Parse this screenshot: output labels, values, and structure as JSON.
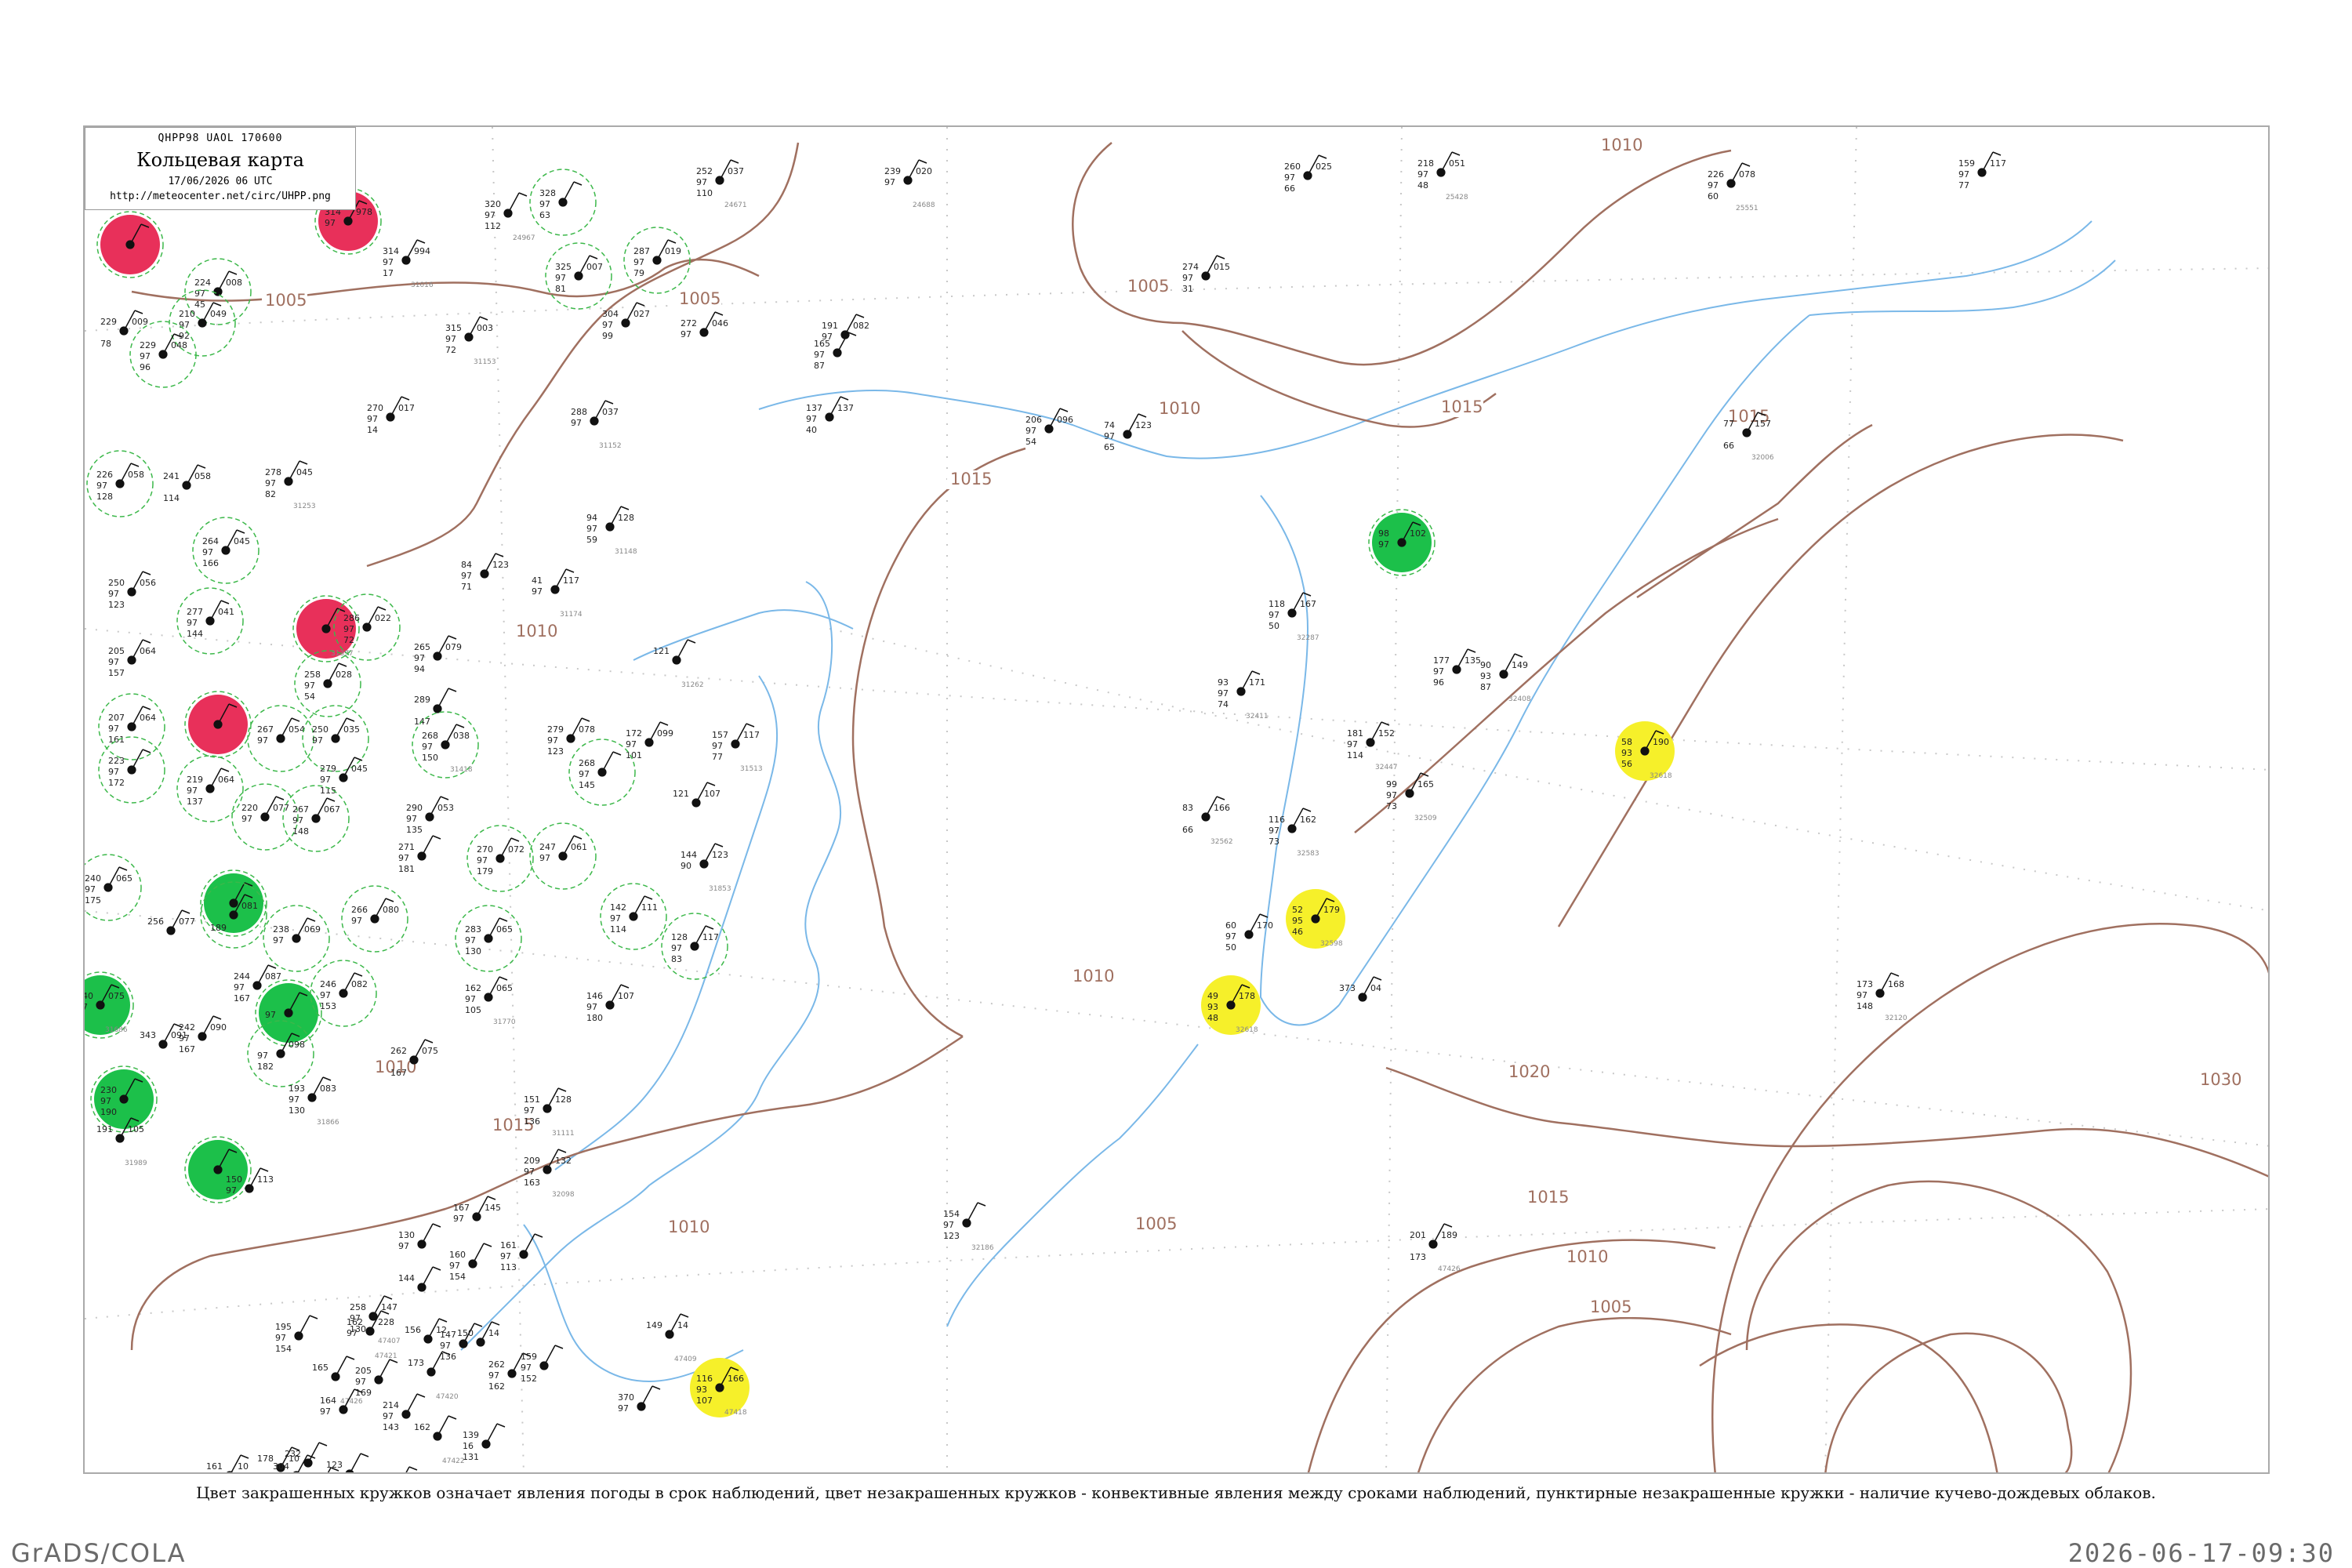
{
  "map_header": {
    "code_line": "QHPP98  UAOL  170600",
    "title": "Кольцевая карта",
    "datetime": "17/06/2026 06 UTC",
    "url": "http://meteocenter.net/circ/UHPP.png"
  },
  "caption": "Цвет закрашенных кружков означает явления погоды в срок наблюдений, цвет незакрашенных кружков - конвективные явления между сроками наблюдений, пунктирные незакрашенные кружки - наличие кучево-дождевых облаков.",
  "footer": {
    "left": "GrADS/COLA",
    "right": "2026-06-17-09:30"
  },
  "colors": {
    "isobar": "#a07060",
    "coast": "#7ab8e8",
    "red": "#e8305a",
    "green": "#1cc04a",
    "yellow": "#f6f02a",
    "dashed_ring": "#3cb84a",
    "station_text": "#222222",
    "station_name": "#888888"
  },
  "isobar_labels": [
    {
      "text": "1005"
    },
    {
      "text": "1005"
    },
    {
      "text": "1005"
    },
    {
      "text": "1010"
    },
    {
      "text": "1010"
    },
    {
      "text": "1010"
    },
    {
      "text": "1015"
    },
    {
      "text": "1015"
    },
    {
      "text": "1015"
    },
    {
      "text": "1010"
    },
    {
      "text": "1010"
    },
    {
      "text": "1020"
    },
    {
      "text": "1030"
    },
    {
      "text": "1015"
    },
    {
      "text": "1010"
    },
    {
      "text": "1005"
    },
    {
      "text": "1005"
    },
    {
      "text": "1010"
    },
    {
      "text": "1015"
    }
  ],
  "stations": [
    {
      "marker": "red",
      "v1": "",
      "v2": "",
      "v3": "",
      "v4": "",
      "id": ""
    },
    {
      "marker": "red",
      "v1": "314",
      "v2": "97",
      "v3": "",
      "v4": "978",
      "id": ""
    },
    {
      "marker": "none",
      "v1": "314",
      "v2": "97",
      "v3": "17",
      "v4": "994",
      "id": "31016"
    },
    {
      "marker": "none",
      "v1": "320",
      "v2": "97",
      "v3": "112",
      "v4": "",
      "id": "24967"
    },
    {
      "marker": "dashed",
      "v1": "328",
      "v2": "97",
      "v3": "63",
      "v4": "",
      "id": ""
    },
    {
      "marker": "none",
      "v1": "252",
      "v2": "97",
      "v3": "110",
      "v4": "037",
      "id": "24671"
    },
    {
      "marker": "none",
      "v1": "239",
      "v2": "97",
      "v3": "",
      "v4": "020",
      "id": "24688"
    },
    {
      "marker": "none",
      "v1": "260",
      "v2": "97",
      "v3": "66",
      "v4": "025",
      "id": ""
    },
    {
      "marker": "none",
      "v1": "218",
      "v2": "97",
      "v3": "48",
      "v4": "051",
      "id": "25428"
    },
    {
      "marker": "none",
      "v1": "226",
      "v2": "97",
      "v3": "60",
      "v4": "078",
      "id": "25551"
    },
    {
      "marker": "none",
      "v1": "159",
      "v2": "97",
      "v3": "77",
      "v4": "117",
      "id": ""
    },
    {
      "marker": "dashed",
      "v1": "224",
      "v2": "97",
      "v3": "45",
      "v4": "008",
      "id": ""
    },
    {
      "marker": "dashed",
      "v1": "210",
      "v2": "97",
      "v3": "92",
      "v4": "049",
      "id": ""
    },
    {
      "marker": "dashed",
      "v1": "229",
      "v2": "97",
      "v3": "96",
      "v4": "048",
      "id": ""
    },
    {
      "marker": "none",
      "v1": "229",
      "v2": "",
      "v3": "78",
      "v4": "009",
      "id": ""
    },
    {
      "marker": "dashed",
      "v1": "287",
      "v2": "97",
      "v3": "79",
      "v4": "019",
      "id": ""
    },
    {
      "marker": "dashed",
      "v1": "325",
      "v2": "97",
      "v3": "81",
      "v4": "007",
      "id": ""
    },
    {
      "marker": "none",
      "v1": "304",
      "v2": "97",
      "v3": "99",
      "v4": "027",
      "id": ""
    },
    {
      "marker": "none",
      "v1": "272",
      "v2": "97",
      "v3": "",
      "v4": "046",
      "id": ""
    },
    {
      "marker": "none",
      "v1": "315",
      "v2": "97",
      "v3": "72",
      "v4": "003",
      "id": "31153"
    },
    {
      "marker": "none",
      "v1": "191",
      "v2": "97",
      "v3": "",
      "v4": "082",
      "id": ""
    },
    {
      "marker": "none",
      "v1": "165",
      "v2": "97",
      "v3": "87",
      "v4": "",
      "id": ""
    },
    {
      "marker": "none",
      "v1": "274",
      "v2": "97",
      "v3": "31",
      "v4": "015",
      "id": ""
    },
    {
      "marker": "none",
      "v1": "270",
      "v2": "97",
      "v3": "14",
      "v4": "017",
      "id": ""
    },
    {
      "marker": "none",
      "v1": "288",
      "v2": "97",
      "v3": "",
      "v4": "037",
      "id": "31152"
    },
    {
      "marker": "none",
      "v1": "137",
      "v2": "97",
      "v3": "40",
      "v4": "137",
      "id": ""
    },
    {
      "marker": "none",
      "v1": "206",
      "v2": "97",
      "v3": "54",
      "v4": "096",
      "id": ""
    },
    {
      "marker": "none",
      "v1": "74",
      "v2": "97",
      "v3": "65",
      "v4": "123",
      "id": ""
    },
    {
      "marker": "dashed",
      "v1": "226",
      "v2": "97",
      "v3": "128",
      "v4": "058",
      "id": ""
    },
    {
      "marker": "none",
      "v1": "278",
      "v2": "97",
      "v3": "82",
      "v4": "045",
      "id": "31253"
    },
    {
      "marker": "none",
      "v1": "241",
      "v2": "",
      "v3": "114",
      "v4": "058",
      "id": ""
    },
    {
      "marker": "none",
      "v1": "94",
      "v2": "97",
      "v3": "59",
      "v4": "128",
      "id": "31148"
    },
    {
      "marker": "dashed",
      "v1": "264",
      "v2": "97",
      "v3": "166",
      "v4": "045",
      "id": ""
    },
    {
      "marker": "none",
      "v1": "250",
      "v2": "97",
      "v3": "123",
      "v4": "056",
      "id": ""
    },
    {
      "marker": "dashed",
      "v1": "277",
      "v2": "97",
      "v3": "144",
      "v4": "041",
      "id": ""
    },
    {
      "marker": "red",
      "v1": "",
      "v2": "",
      "v3": "",
      "v4": "",
      "id": "31397"
    },
    {
      "marker": "dashed",
      "v1": "286",
      "v2": "97",
      "v3": "72",
      "v4": "022",
      "id": ""
    },
    {
      "marker": "none",
      "v1": "84",
      "v2": "97",
      "v3": "71",
      "v4": "123",
      "id": ""
    },
    {
      "marker": "none",
      "v1": "41",
      "v2": "97",
      "v3": "",
      "v4": "117",
      "id": "31174"
    },
    {
      "marker": "none",
      "v1": "205",
      "v2": "97",
      "v3": "157",
      "v4": "064",
      "id": ""
    },
    {
      "marker": "dashed",
      "v1": "258",
      "v2": "97",
      "v3": "54",
      "v4": "028",
      "id": ""
    },
    {
      "marker": "none",
      "v1": "265",
      "v2": "97",
      "v3": "94",
      "v4": "079",
      "id": ""
    },
    {
      "marker": "none",
      "v1": "121",
      "v2": "",
      "v3": "",
      "v4": "",
      "id": "31262"
    },
    {
      "marker": "dashed",
      "v1": "207",
      "v2": "97",
      "v3": "161",
      "v4": "064",
      "id": ""
    },
    {
      "marker": "red",
      "v1": "",
      "v2": "",
      "v3": "",
      "v4": "",
      "id": ""
    },
    {
      "marker": "dashed",
      "v1": "267",
      "v2": "97",
      "v3": "",
      "v4": "054",
      "id": ""
    },
    {
      "marker": "dashed",
      "v1": "250",
      "v2": "97",
      "v3": "",
      "v4": "035",
      "id": ""
    },
    {
      "marker": "none",
      "v1": "289",
      "v2": "",
      "v3": "147",
      "v4": "",
      "id": ""
    },
    {
      "marker": "dashed",
      "v1": "268",
      "v2": "97",
      "v3": "150",
      "v4": "038",
      "id": "31418"
    },
    {
      "marker": "none",
      "v1": "279",
      "v2": "97",
      "v3": "123",
      "v4": "078",
      "id": ""
    },
    {
      "marker": "none",
      "v1": "172",
      "v2": "97",
      "v3": "101",
      "v4": "099",
      "id": ""
    },
    {
      "marker": "none",
      "v1": "157",
      "v2": "97",
      "v3": "77",
      "v4": "117",
      "id": "31513"
    },
    {
      "marker": "dashed",
      "v1": "223",
      "v2": "97",
      "v3": "172",
      "v4": "",
      "id": ""
    },
    {
      "marker": "dashed",
      "v1": "219",
      "v2": "97",
      "v3": "137",
      "v4": "064",
      "id": ""
    },
    {
      "marker": "none",
      "v1": "279",
      "v2": "97",
      "v3": "115",
      "v4": "045",
      "id": ""
    },
    {
      "marker": "dashed",
      "v1": "268",
      "v2": "97",
      "v3": "145",
      "v4": "",
      "id": ""
    },
    {
      "marker": "none",
      "v1": "121",
      "v2": "",
      "v3": "",
      "v4": "107",
      "id": ""
    },
    {
      "marker": "dashed",
      "v1": "220",
      "v2": "97",
      "v3": "",
      "v4": "077",
      "id": ""
    },
    {
      "marker": "dashed",
      "v1": "267",
      "v2": "97",
      "v3": "148",
      "v4": "067",
      "id": ""
    },
    {
      "marker": "none",
      "v1": "290",
      "v2": "97",
      "v3": "135",
      "v4": "053",
      "id": ""
    },
    {
      "marker": "none",
      "v1": "271",
      "v2": "97",
      "v3": "181",
      "v4": "",
      "id": ""
    },
    {
      "marker": "dashed",
      "v1": "270",
      "v2": "97",
      "v3": "179",
      "v4": "072",
      "id": ""
    },
    {
      "marker": "dashed",
      "v1": "247",
      "v2": "97",
      "v3": "",
      "v4": "061",
      "id": ""
    },
    {
      "marker": "none",
      "v1": "144",
      "v2": "90",
      "v3": "",
      "v4": "123",
      "id": "31853"
    },
    {
      "marker": "dashed",
      "v1": "240",
      "v2": "97",
      "v3": "175",
      "v4": "065",
      "id": ""
    },
    {
      "marker": "green",
      "v1": "",
      "v2": "",
      "v3": "",
      "v4": "",
      "id": ""
    },
    {
      "marker": "dashed",
      "v1": "",
      "v2": "",
      "v3": "189",
      "v4": "081",
      "id": ""
    },
    {
      "marker": "none",
      "v1": "256",
      "v2": "",
      "v3": "",
      "v4": "077",
      "id": ""
    },
    {
      "marker": "dashed",
      "v1": "238",
      "v2": "97",
      "v3": "",
      "v4": "069",
      "id": ""
    },
    {
      "marker": "dashed",
      "v1": "266",
      "v2": "97",
      "v3": "",
      "v4": "080",
      "id": ""
    },
    {
      "marker": "dashed",
      "v1": "283",
      "v2": "97",
      "v3": "130",
      "v4": "065",
      "id": ""
    },
    {
      "marker": "dashed",
      "v1": "142",
      "v2": "97",
      "v3": "114",
      "v4": "111",
      "id": ""
    },
    {
      "marker": "dashed",
      "v1": "128",
      "v2": "97",
      "v3": "83",
      "v4": "117",
      "id": ""
    },
    {
      "marker": "green",
      "v1": "240",
      "v2": "97",
      "v3": "",
      "v4": "075",
      "id": "31686"
    },
    {
      "marker": "none",
      "v1": "244",
      "v2": "97",
      "v3": "167",
      "v4": "087",
      "id": ""
    },
    {
      "marker": "green",
      "v1": "",
      "v2": "97",
      "v3": "",
      "v4": "",
      "id": ""
    },
    {
      "marker": "dashed",
      "v1": "246",
      "v2": "97",
      "v3": "153",
      "v4": "082",
      "id": ""
    },
    {
      "marker": "none",
      "v1": "162",
      "v2": "97",
      "v3": "105",
      "v4": "065",
      "id": "31770"
    },
    {
      "marker": "none",
      "v1": "146",
      "v2": "97",
      "v3": "180",
      "v4": "107",
      "id": ""
    },
    {
      "marker": "none",
      "v1": "242",
      "v2": "97",
      "v3": "167",
      "v4": "090",
      "id": ""
    },
    {
      "marker": "none",
      "v1": "343",
      "v2": "",
      "v3": "",
      "v4": "091",
      "id": ""
    },
    {
      "marker": "dashed",
      "v1": "",
      "v2": "97",
      "v3": "182",
      "v4": "098",
      "id": ""
    },
    {
      "marker": "none",
      "v1": "262",
      "v2": "",
      "v3": "167",
      "v4": "075",
      "id": ""
    },
    {
      "marker": "none",
      "v1": "151",
      "v2": "97",
      "v3": "136",
      "v4": "128",
      "id": "31111"
    },
    {
      "marker": "green",
      "v1": "230",
      "v2": "97",
      "v3": "190",
      "v4": "",
      "id": ""
    },
    {
      "marker": "none",
      "v1": "193",
      "v2": "97",
      "v3": "130",
      "v4": "083",
      "id": "31866"
    },
    {
      "marker": "none",
      "v1": "209",
      "v2": "97",
      "v3": "163",
      "v4": "132",
      "id": "32098"
    },
    {
      "marker": "none",
      "v1": "191",
      "v2": "",
      "v3": "",
      "v4": "105",
      "id": "31989"
    },
    {
      "marker": "green",
      "v1": "",
      "v2": "",
      "v3": "",
      "v4": "",
      "id": ""
    },
    {
      "marker": "none",
      "v1": "150",
      "v2": "97",
      "v3": "",
      "v4": "113",
      "id": ""
    },
    {
      "marker": "none",
      "v1": "167",
      "v2": "97",
      "v3": "",
      "v4": "145",
      "id": ""
    },
    {
      "marker": "none",
      "v1": "130",
      "v2": "97",
      "v3": "",
      "v4": "",
      "id": ""
    },
    {
      "marker": "none",
      "v1": "160",
      "v2": "97",
      "v3": "154",
      "v4": "",
      "id": ""
    },
    {
      "marker": "none",
      "v1": "161",
      "v2": "97",
      "v3": "113",
      "v4": "",
      "id": ""
    },
    {
      "marker": "none",
      "v1": "144",
      "v2": "",
      "v3": "",
      "v4": "",
      "id": ""
    },
    {
      "marker": "none",
      "v1": "258",
      "v2": "97",
      "v3": "130",
      "v4": "147",
      "id": "47407"
    },
    {
      "marker": "none",
      "v1": "195",
      "v2": "97",
      "v3": "154",
      "v4": "",
      "id": ""
    },
    {
      "marker": "none",
      "v1": "162",
      "v2": "97",
      "v3": "",
      "v4": "228",
      "id": "47421"
    },
    {
      "marker": "none",
      "v1": "156",
      "v2": "",
      "v3": "",
      "v4": "12",
      "id": ""
    },
    {
      "marker": "none",
      "v1": "147",
      "v2": "97",
      "v3": "136",
      "v4": "",
      "id": ""
    },
    {
      "marker": "none",
      "v1": "173",
      "v2": "",
      "v3": "",
      "v4": "",
      "id": "47420"
    },
    {
      "marker": "none",
      "v1": "262",
      "v2": "97",
      "v3": "162",
      "v4": "",
      "id": ""
    },
    {
      "marker": "none",
      "v1": "150",
      "v2": "",
      "v3": "",
      "v4": "14",
      "id": ""
    },
    {
      "marker": "none",
      "v1": "159",
      "v2": "97",
      "v3": "152",
      "v4": "",
      "id": ""
    },
    {
      "marker": "none",
      "v1": "149",
      "v2": "",
      "v3": "",
      "v4": "14",
      "id": "47409"
    },
    {
      "marker": "yellow",
      "v1": "116",
      "v2": "93",
      "v3": "107",
      "v4": "166",
      "id": "47418"
    },
    {
      "marker": "none",
      "v1": "370",
      "v2": "97",
      "v3": "",
      "v4": "",
      "id": ""
    },
    {
      "marker": "none",
      "v1": "165",
      "v2": "",
      "v3": "",
      "v4": "",
      "id": "47426"
    },
    {
      "marker": "none",
      "v1": "205",
      "v2": "97",
      "v3": "169",
      "v4": "",
      "id": ""
    },
    {
      "marker": "none",
      "v1": "164",
      "v2": "97",
      "v3": "",
      "v4": "",
      "id": ""
    },
    {
      "marker": "none",
      "v1": "214",
      "v2": "97",
      "v3": "143",
      "v4": "",
      "id": ""
    },
    {
      "marker": "none",
      "v1": "162",
      "v2": "",
      "v3": "",
      "v4": "",
      "id": "47422"
    },
    {
      "marker": "none",
      "v1": "139",
      "v2": "16",
      "v3": "131",
      "v4": "",
      "id": ""
    },
    {
      "marker": "none",
      "v1": "178",
      "v2": "",
      "v3": "",
      "v4": "10",
      "id": "47428"
    },
    {
      "marker": "none",
      "v1": "232",
      "v2": "",
      "v3": "155",
      "v4": "",
      "id": ""
    },
    {
      "marker": "none",
      "v1": "161",
      "v2": "",
      "v3": "",
      "v4": "10",
      "id": ""
    },
    {
      "marker": "none",
      "v1": "123",
      "v2": "",
      "v3": "162",
      "v4": "",
      "id": ""
    },
    {
      "marker": "none",
      "v1": "160",
      "v2": "97",
      "v3": "",
      "v4": "",
      "id": "47574"
    },
    {
      "marker": "none",
      "v1": "190",
      "v2": "97",
      "v3": "168",
      "v4": "",
      "id": ""
    },
    {
      "marker": "none",
      "v1": "163",
      "v2": "",
      "v3": "",
      "v4": "11",
      "id": ""
    },
    {
      "marker": "none",
      "v1": "281",
      "v2": "97",
      "v3": "103",
      "v4": "",
      "id": ""
    },
    {
      "marker": "none",
      "v1": "153",
      "v2": "",
      "v3": "",
      "v4": "14",
      "id": ""
    },
    {
      "marker": "none",
      "v1": "304",
      "v2": "97",
      "v3": "119",
      "v4": "",
      "id": ""
    },
    {
      "marker": "none",
      "v1": "142",
      "v2": "",
      "v3": "",
      "v4": "14",
      "id": "47594"
    },
    {
      "marker": "none",
      "v1": "154",
      "v2": "97",
      "v3": "123",
      "v4": "",
      "id": "32186"
    },
    {
      "marker": "green",
      "v1": "98",
      "v2": "97",
      "v3": "",
      "v4": "102",
      "id": ""
    },
    {
      "marker": "none",
      "v1": "118",
      "v2": "97",
      "v3": "50",
      "v4": "167",
      "id": "32287"
    },
    {
      "marker": "none",
      "v1": "93",
      "v2": "97",
      "v3": "74",
      "v4": "171",
      "id": "32411"
    },
    {
      "marker": "none",
      "v1": "177",
      "v2": "97",
      "v3": "96",
      "v4": "135",
      "id": ""
    },
    {
      "marker": "none",
      "v1": "90",
      "v2": "93",
      "v3": "87",
      "v4": "149",
      "id": "32408"
    },
    {
      "marker": "none",
      "v1": "181",
      "v2": "97",
      "v3": "114",
      "v4": "152",
      "id": "32447"
    },
    {
      "marker": "yellow",
      "v1": "58",
      "v2": "93",
      "v3": "56",
      "v4": "190",
      "id": "32618"
    },
    {
      "marker": "none",
      "v1": "99",
      "v2": "97",
      "v3": "73",
      "v4": "165",
      "id": "32509"
    },
    {
      "marker": "none",
      "v1": "83",
      "v2": "",
      "v3": "66",
      "v4": "166",
      "id": "32562"
    },
    {
      "marker": "none",
      "v1": "116",
      "v2": "97",
      "v3": "73",
      "v4": "162",
      "id": "32583"
    },
    {
      "marker": "yellow",
      "v1": "52",
      "v2": "95",
      "v3": "46",
      "v4": "179",
      "id": "32598"
    },
    {
      "marker": "none",
      "v1": "60",
      "v2": "97",
      "v3": "50",
      "v4": "170",
      "id": ""
    },
    {
      "marker": "yellow",
      "v1": "49",
      "v2": "93",
      "v3": "48",
      "v4": "178",
      "id": "32618"
    },
    {
      "marker": "none",
      "v1": "373",
      "v2": "",
      "v3": "",
      "v4": "04",
      "id": ""
    },
    {
      "marker": "none",
      "v1": "173",
      "v2": "97",
      "v3": "148",
      "v4": "168",
      "id": "32120"
    },
    {
      "marker": "none",
      "v1": "77",
      "v2": "",
      "v3": "66",
      "v4": "157",
      "id": "32006"
    },
    {
      "marker": "none",
      "v1": "201",
      "v2": "",
      "v3": "173",
      "v4": "189",
      "id": "47426"
    }
  ]
}
